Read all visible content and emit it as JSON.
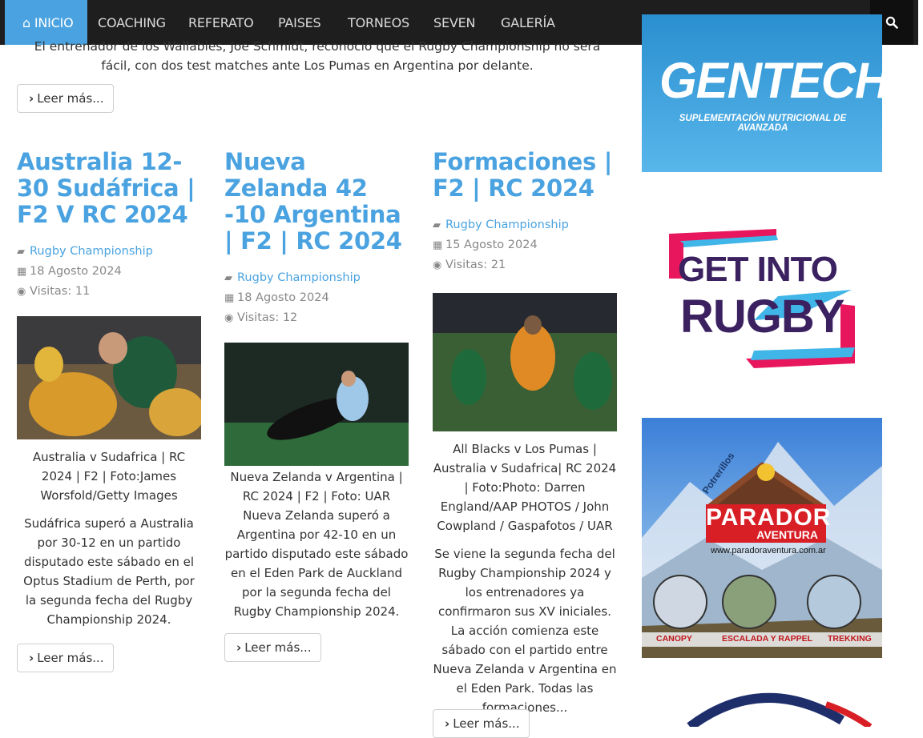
{
  "nav": {
    "items": [
      "INICIO",
      "COACHING",
      "REFERATO",
      "PAISES",
      "TORNEOS",
      "SEVEN",
      "GALERÍA"
    ],
    "search_icon": "search-icon",
    "accent": "#4aa3e0"
  },
  "top_article": {
    "excerpt": "El entrenador de los Wallabies, Joe Schmidt, reconoció que el Rugby Championship no será fácil, con dos test matches ante Los Pumas en Argentina por delante.",
    "read_more": "Leer más..."
  },
  "articles": [
    {
      "title": "Australia 12-30 Sudáfrica | F2 V RC 2024",
      "category": "Rugby Championship",
      "date": "18 Agosto 2024",
      "visits": "Visitas: 11",
      "caption": "Australia v Sudafrica | RC 2024 | F2 | Foto:James Worsfold/Getty Images",
      "body": "Sudáfrica superó a Australia por 30-12 en un partido disputado este sábado en el Optus Stadium de Perth, por la segunda fecha del Rugby Championship 2024.",
      "read_more": "Leer más..."
    },
    {
      "title": "Nueva Zelanda 42 -10 Argentina | F2 | RC 2024",
      "category": "Rugby Championship",
      "date": "18 Agosto 2024",
      "visits": "Visitas: 12",
      "caption": "Nueva Zelanda v Argentina | RC 2024 | F2 | Foto: UAR",
      "body": "Nueva Zelanda superó a Argentina por 42-10 en un partido disputado este sábado en el Eden Park de Auckland por la segunda fecha del Rugby Championship 2024.",
      "read_more": "Leer más..."
    },
    {
      "title": "Formaciones | F2 | RC 2024",
      "category": "Rugby Championship",
      "date": "15 Agosto 2024",
      "visits": "Visitas: 21",
      "caption": "All Blacks v Los Pumas | Australia v Sudafrica| RC 2024 | Foto:Photo: Darren England/AAP PHOTOS / John Cowpland / Gaspafotos / UAR",
      "body": "Se viene la segunda fecha del Rugby Championship 2024 y los entrenadores ya confirmaron sus XV iniciales. La acción comienza este sábado con el partido entre Nueva Zelanda v Argentina en el Eden Park. Todas las formaciones...",
      "read_more": "Leer más..."
    }
  ],
  "ads": {
    "gentech": {
      "brand": "GENTECH",
      "tagline": "SUPLEMENTACIÓN NUTRICIONAL DE AVANZADA"
    },
    "get_into_rugby": {
      "line1": "GET INTO",
      "line2": "RUGBY"
    },
    "parador": {
      "place": "Potrerillos",
      "brand": "PARADOR",
      "sub": "AVENTURA",
      "url": "www.paradoraventura.com.ar",
      "activities": [
        "CANOPY",
        "ESCALADA Y RAPPEL",
        "TREKKING"
      ]
    }
  }
}
